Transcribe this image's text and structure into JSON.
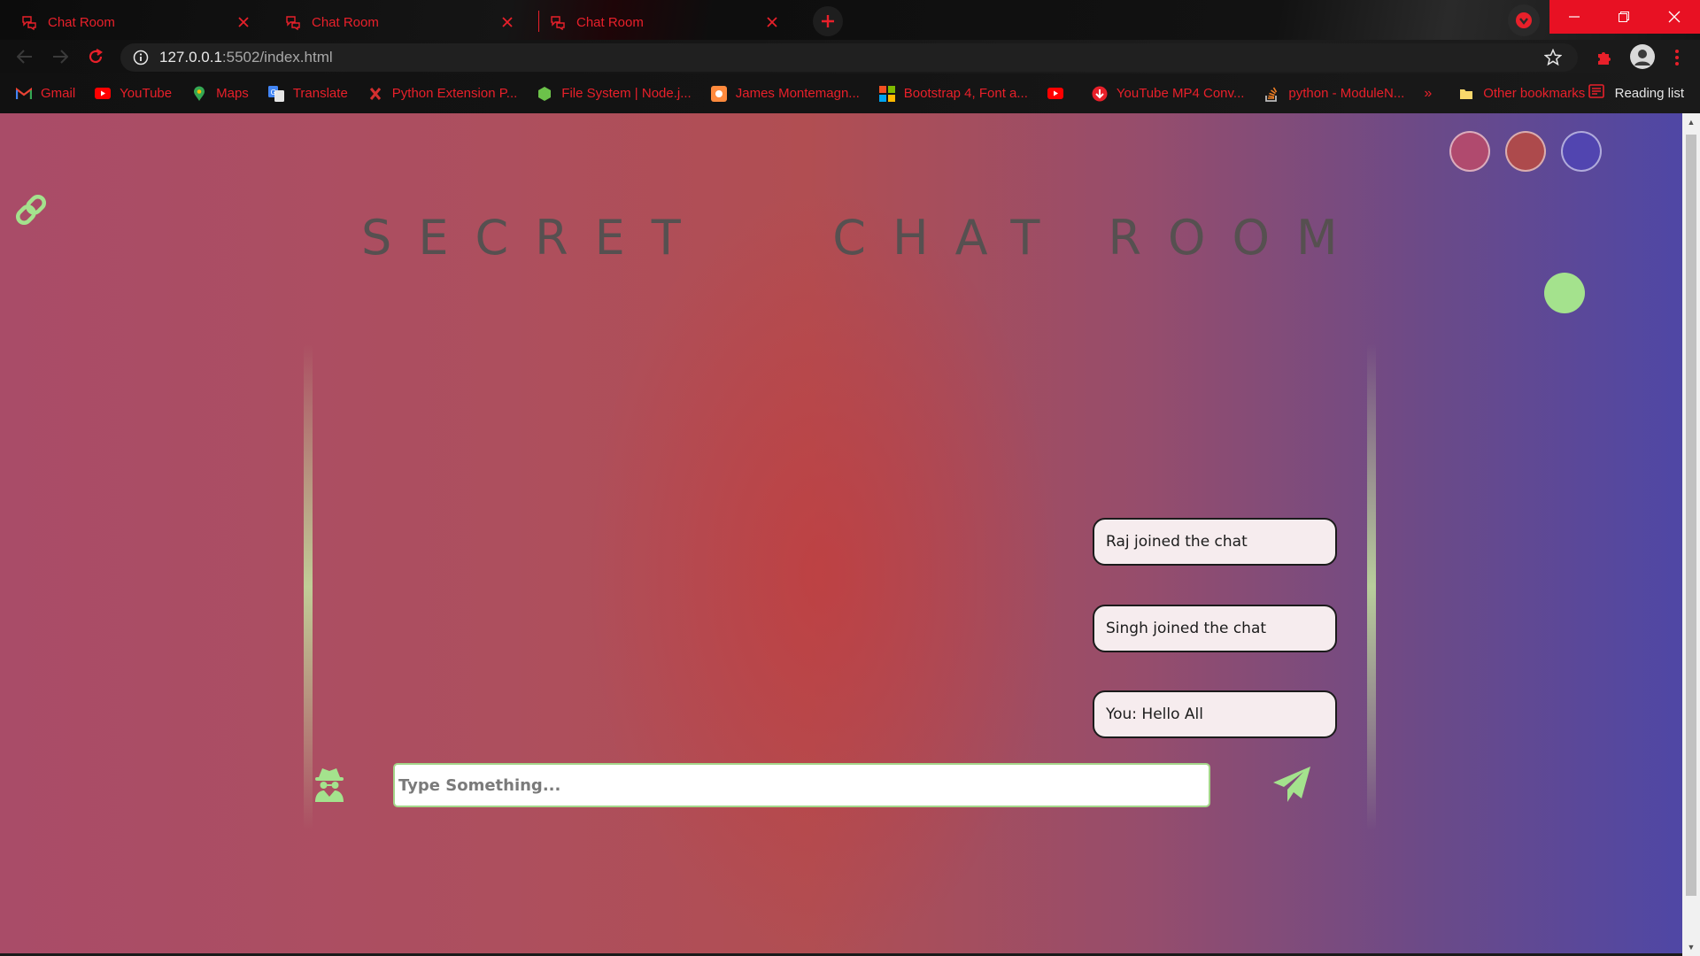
{
  "browser": {
    "tabs": [
      {
        "title": "Chat Room"
      },
      {
        "title": "Chat Room"
      },
      {
        "title": "Chat Room"
      }
    ],
    "url_host": "127.0.0.1",
    "url_rest": ":5502/index.html",
    "bookmarks": [
      {
        "label": "Gmail",
        "icon": "gmail-icon",
        "color": "#ea4335"
      },
      {
        "label": "YouTube",
        "icon": "youtube-icon",
        "color": "#ff0000"
      },
      {
        "label": "Maps",
        "icon": "maps-icon",
        "color": "#34a853"
      },
      {
        "label": "Translate",
        "icon": "translate-icon",
        "color": "#4285f4"
      },
      {
        "label": "Python Extension P...",
        "icon": "python-ext-icon",
        "color": "#d32f2f"
      },
      {
        "label": "File System | Node.j...",
        "icon": "nodejs-icon",
        "color": "#6cc24a"
      },
      {
        "label": "James Montemagn...",
        "icon": "blog-icon",
        "color": "#ff8a3d"
      },
      {
        "label": "Bootstrap 4, Font a...",
        "icon": "microsoft-icon",
        "color": "#f25022"
      },
      {
        "label": "",
        "icon": "youtube-icon",
        "color": "#ff0000"
      },
      {
        "label": "YouTube MP4 Conv...",
        "icon": "download-icon",
        "color": "#e8202a"
      },
      {
        "label": "python - ModuleN...",
        "icon": "stackoverflow-icon",
        "color": "#f48024"
      }
    ],
    "other_bookmarks": "Other bookmarks",
    "reading_list": "Reading list"
  },
  "page": {
    "title_left": "SECRET",
    "title_right": "CHAT ROOM",
    "theme_swatches": [
      {
        "name": "pink",
        "color": "#b04a6e"
      },
      {
        "name": "red",
        "color": "#ad4a4c"
      },
      {
        "name": "indigo",
        "color": "#5145b0"
      }
    ],
    "messages": [
      {
        "text": "Raj joined the chat"
      },
      {
        "text": "Singh joined the chat"
      },
      {
        "text": "You: Hello All"
      }
    ],
    "input_placeholder": "Type Something...",
    "accent_green": "#a4e28d"
  }
}
